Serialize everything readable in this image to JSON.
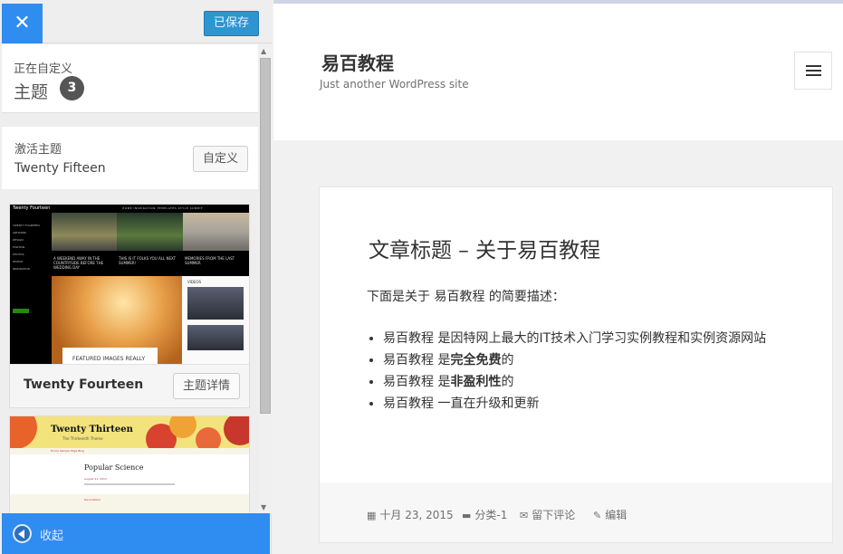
{
  "sidebar": {
    "close_glyph": "✕",
    "save_label": "已保存",
    "customizing_label": "正在自定义",
    "section_name": "主题",
    "theme_count": "3",
    "active_theme_label": "激活主题",
    "active_theme_name": "Twenty Fifteen",
    "customize_label": "自定义",
    "themes": [
      {
        "name": "Twenty Fourteen",
        "details_label": "主题详情",
        "shot": {
          "site_title": "Twenty Fourteen",
          "nav": "HOME   INSPIRATION   TEMPLATES   STYLE   SUBMIT",
          "side_items": [
            "TWENTY FOURTEEN",
            "ARTWORK",
            "DESIGN",
            "FASHION",
            "PHOTOS",
            "PEOPLE",
            "INSPIRATION"
          ],
          "strip_texts": [
            "A WEEKEND AWAY IN THE COUNTRYSIDE BEFORE THE WEDDING DAY",
            "THIS IS IT FOLKS YOU ALL NEXT SUMMER!",
            "MEMORIES FROM THE LAST SUMMER"
          ],
          "caption": "FEATURED IMAGES REALLY",
          "widget_label": "VIDEOS"
        }
      },
      {
        "name": "Twenty Thirteen",
        "shot": {
          "site_title": "Twenty Thirteen",
          "tagline": "The Thirteenth Theme",
          "nav": "Home   Sample Page   Blog",
          "post_title": "Popular Science",
          "meta": "August 21, 2013",
          "band": "Decorations"
        }
      }
    ],
    "collapse_label": "收起"
  },
  "preview": {
    "site_title": "易百教程",
    "site_description": "Just another WordPress site",
    "post": {
      "title": "文章标题 – 关于易百教程",
      "intro": "下面是关于 易百教程 的简要描述：",
      "items": [
        {
          "pre": "易百教程 是因特网上最大的IT技术入门学习实例教程和实例资源网站",
          "bold": "",
          "post": ""
        },
        {
          "pre": "易百教程 是",
          "bold": "完全免费",
          "post": "的"
        },
        {
          "pre": "易百教程 是",
          "bold": "非盈利性",
          "post": "的"
        },
        {
          "pre": "易百教程 一直在升级和更新",
          "bold": "",
          "post": ""
        }
      ]
    },
    "footer": {
      "date": "十月 23, 2015",
      "category": "分类-1",
      "comment": "留下评论",
      "edit": "编辑"
    }
  },
  "icons": {
    "calendar": "▦",
    "folder": "▬",
    "comment": "✉",
    "pencil": "✎"
  }
}
